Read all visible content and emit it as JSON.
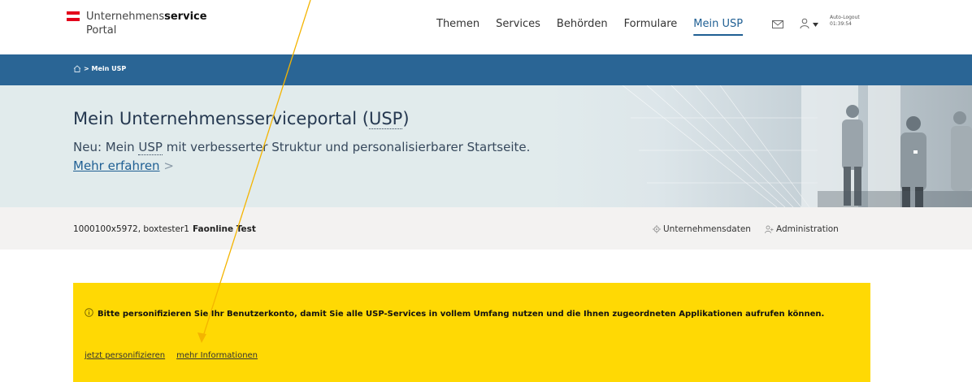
{
  "header": {
    "logo_line1": "Unternehmens",
    "logo_line1_bold": "service",
    "logo_line2": "Portal",
    "nav": [
      "Themen",
      "Services",
      "Behörden",
      "Formulare",
      "Mein USP"
    ],
    "active_nav": "Mein USP",
    "logout_label": "Auto-Logout",
    "logout_time": "01:39:54",
    "icons": [
      "mail-icon",
      "user-icon",
      "caret-down-icon"
    ]
  },
  "breadcrumb": {
    "home_icon": "home-icon",
    "current": "Mein USP"
  },
  "hero": {
    "title_prefix": "Mein Unternehmensserviceportal (",
    "title_abbr": "USP",
    "title_suffix": ")",
    "sub_prefix": "Neu: Mein ",
    "sub_abbr": "USP",
    "sub_middle": " mit verbesserter Struktur und personalisierbarer Startseite. ",
    "sub_link": "Mehr erfahren",
    "sub_chevron": ">"
  },
  "account": {
    "id_text": "1000100x5972, boxtester1",
    "name": "Faonline Test",
    "link_company": "Unternehmensdaten",
    "link_admin": "Administration"
  },
  "notice": {
    "icon": "info-icon",
    "text": "Bitte personifizieren Sie Ihr Benutzerkonto, damit Sie alle USP-Services in vollem Umfang nutzen und die Ihnen zugeordneten Applikationen aufrufen können.",
    "link_personalize": "jetzt personifizieren",
    "link_info": "mehr Informationen"
  },
  "colors": {
    "brand_blue": "#2a6595",
    "notice_yellow": "#ffd904",
    "hero_bg": "#e1ebec",
    "flag_red": "#e3001b",
    "annotation_arrow": "#f4b400"
  }
}
